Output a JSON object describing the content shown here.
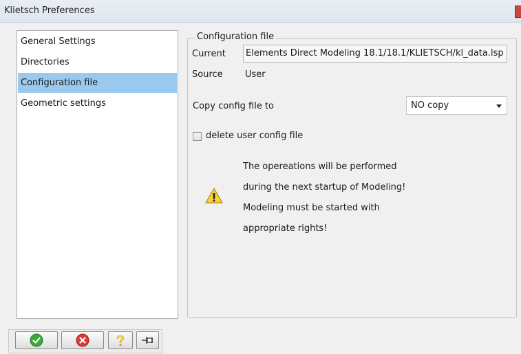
{
  "window": {
    "title": "Klietsch Preferences"
  },
  "sidebar": {
    "items": [
      {
        "label": "General Settings",
        "selected": false
      },
      {
        "label": "Directories",
        "selected": false
      },
      {
        "label": "Configuration file",
        "selected": true
      },
      {
        "label": "Geometric settings",
        "selected": false
      }
    ]
  },
  "config": {
    "group_title": "Configuration file",
    "current_label": "Current",
    "current_value": "Elements Direct Modeling 18.1/18.1/KLIETSCH/kl_data.lsp",
    "source_label": "Source",
    "source_value": "User",
    "copy_label": "Copy config file to",
    "copy_selected": "NO copy",
    "delete_checkbox_label": "delete user config file",
    "delete_checked": false,
    "warning_lines": [
      "The opereations will be performed",
      "during the next startup of Modeling!",
      "Modeling must be started with",
      "appropriate rights!"
    ]
  },
  "toolbar": {
    "buttons": [
      {
        "name": "ok",
        "icon": "check-circle-icon",
        "color": "#3aa83a"
      },
      {
        "name": "cancel",
        "icon": "x-circle-icon",
        "color": "#d83b3b"
      },
      {
        "name": "help",
        "icon": "question-icon",
        "color": "#e0c020"
      },
      {
        "name": "pin",
        "icon": "pushpin-icon",
        "color": "#333333"
      }
    ]
  },
  "colors": {
    "selection": "#99c9ef",
    "window_bg": "#f0f0f0"
  }
}
